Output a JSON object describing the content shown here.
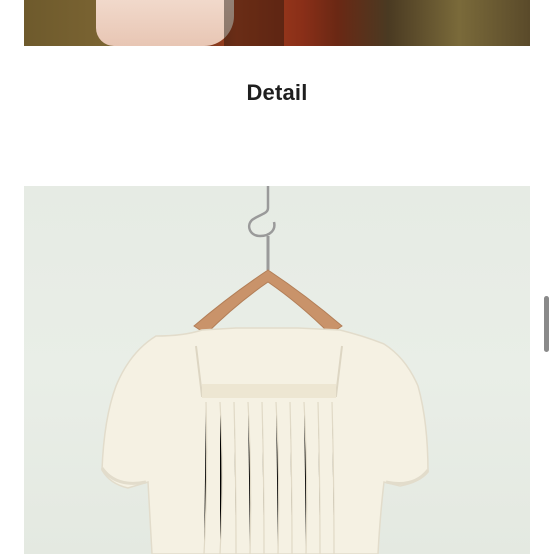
{
  "page": {
    "section_title": "Detail"
  },
  "images": {
    "top_photo_alt": "",
    "detail_photo_alt": ""
  },
  "colors": {
    "background": "#ffffff",
    "title_text": "#1f1f1f",
    "photo_backdrop": "#e6ebe4",
    "scrollbar": "#8a8a8a"
  }
}
